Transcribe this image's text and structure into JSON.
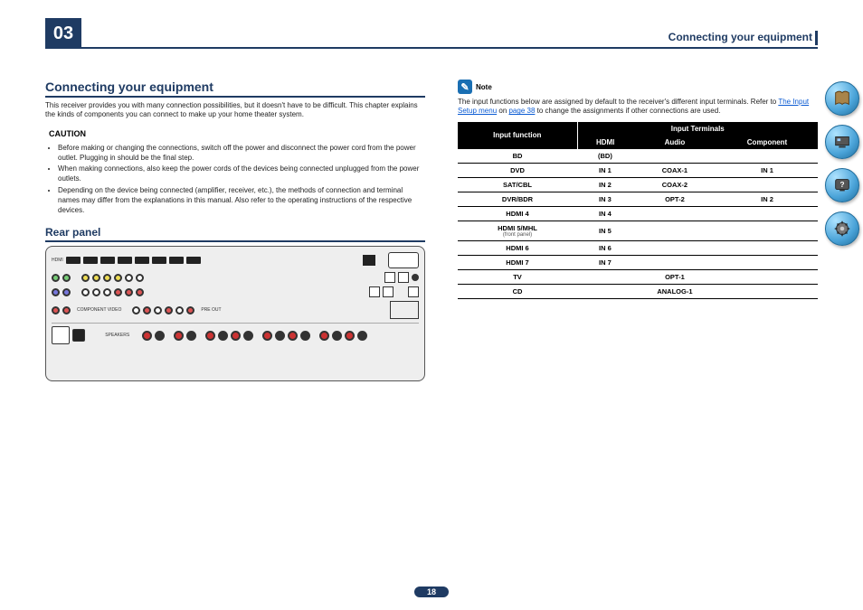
{
  "chapter_number": "03",
  "header_title": "Connecting your equipment",
  "page_number": "18",
  "left": {
    "h1": "Connecting your equipment",
    "intro": "This receiver provides you with many connection possibilities, but it doesn't have to be difficult. This chapter explains the kinds of components you can connect to make up your home theater system.",
    "caution_label": "CAUTION",
    "cautions": [
      "Before making or changing the connections, switch off the power and disconnect the power cord from the power outlet. Plugging in should be the final step.",
      "When making connections, also keep the power cords of the devices being connected unplugged from the power outlets.",
      "Depending on the device being connected (amplifier, receiver, etc.), the methods of connection and terminal names may differ from the explanations in this manual. Also refer to the operating instructions of the respective devices."
    ],
    "h2": "Rear panel"
  },
  "right": {
    "note_label": "Note",
    "note_text_pre": "The input functions below are assigned by default to the receiver's different input terminals. Refer to ",
    "note_link": "The Input Setup menu",
    "note_text_mid": " on ",
    "note_link2": "page 38",
    "note_text_post": " to change the assignments if other connections are used.",
    "table": {
      "head_function": "Input function",
      "head_terminals": "Input Terminals",
      "cols": [
        "HDMI",
        "Audio",
        "Component"
      ],
      "rows": [
        {
          "fn": "BD",
          "hdmi": "(BD)",
          "audio": "",
          "comp": ""
        },
        {
          "fn": "DVD",
          "hdmi": "IN 1",
          "audio": "COAX-1",
          "comp": "IN 1"
        },
        {
          "fn": "SAT/CBL",
          "hdmi": "IN 2",
          "audio": "COAX-2",
          "comp": ""
        },
        {
          "fn": "DVR/BDR",
          "hdmi": "IN 3",
          "audio": "OPT-2",
          "comp": "IN 2"
        },
        {
          "fn": "HDMI 4",
          "hdmi": "IN 4",
          "audio": "",
          "comp": ""
        },
        {
          "fn": "HDMI 5/MHL",
          "fn_note": "(front panel)",
          "hdmi": "IN 5",
          "audio": "",
          "comp": ""
        },
        {
          "fn": "HDMI 6",
          "hdmi": "IN 6",
          "audio": "",
          "comp": ""
        },
        {
          "fn": "HDMI 7",
          "hdmi": "IN 7",
          "audio": "",
          "comp": ""
        },
        {
          "fn": "TV",
          "hdmi": "",
          "audio": "OPT-1",
          "comp": ""
        },
        {
          "fn": "CD",
          "hdmi": "",
          "audio": "ANALOG-1",
          "comp": ""
        }
      ]
    }
  },
  "side_icons": [
    "book-icon",
    "device-icon",
    "help-icon",
    "settings-icon"
  ]
}
